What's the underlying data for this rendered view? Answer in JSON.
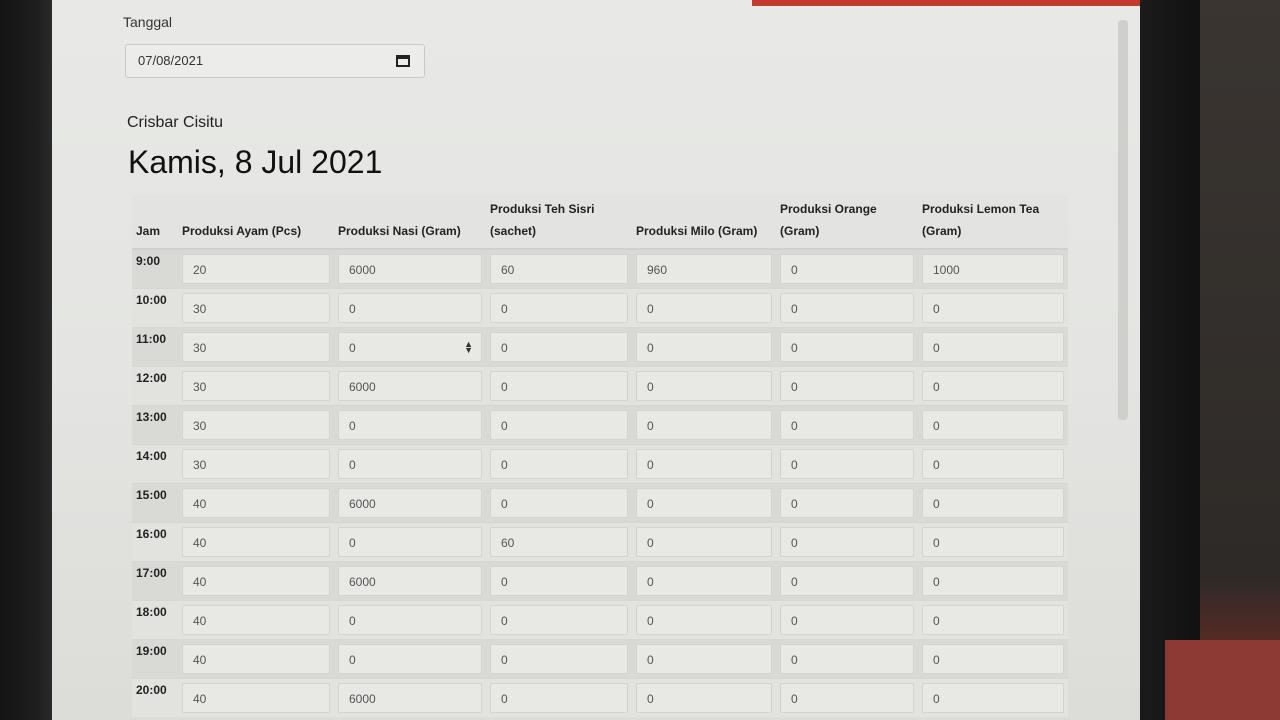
{
  "form": {
    "date_label": "Tanggal",
    "date_value": "07/08/2021",
    "store_name": "Crisbar Cisitu",
    "day_title": "Kamis, 8 Jul 2021"
  },
  "table": {
    "headers": [
      "Jam",
      "Produksi Ayam (Pcs)",
      "Produksi Nasi (Gram)",
      "Produksi Teh Sisri (sachet)",
      "Produksi Milo (Gram)",
      "Produksi Orange (Gram)",
      "Produksi Lemon Tea (Gram)"
    ],
    "rows": [
      {
        "jam": "9:00",
        "values": [
          "20",
          "6000",
          "60",
          "960",
          "0",
          "1000"
        ]
      },
      {
        "jam": "10:00",
        "values": [
          "30",
          "0",
          "0",
          "0",
          "0",
          "0"
        ]
      },
      {
        "jam": "11:00",
        "values": [
          "30",
          "0",
          "0",
          "0",
          "0",
          "0"
        ]
      },
      {
        "jam": "12:00",
        "values": [
          "30",
          "6000",
          "0",
          "0",
          "0",
          "0"
        ]
      },
      {
        "jam": "13:00",
        "values": [
          "30",
          "0",
          "0",
          "0",
          "0",
          "0"
        ]
      },
      {
        "jam": "14:00",
        "values": [
          "30",
          "0",
          "0",
          "0",
          "0",
          "0"
        ]
      },
      {
        "jam": "15:00",
        "values": [
          "40",
          "6000",
          "0",
          "0",
          "0",
          "0"
        ]
      },
      {
        "jam": "16:00",
        "values": [
          "40",
          "0",
          "60",
          "0",
          "0",
          "0"
        ]
      },
      {
        "jam": "17:00",
        "values": [
          "40",
          "6000",
          "0",
          "0",
          "0",
          "0"
        ]
      },
      {
        "jam": "18:00",
        "values": [
          "40",
          "0",
          "0",
          "0",
          "0",
          "0"
        ]
      },
      {
        "jam": "19:00",
        "values": [
          "40",
          "0",
          "0",
          "0",
          "0",
          "0"
        ]
      },
      {
        "jam": "20:00",
        "values": [
          "40",
          "6000",
          "0",
          "0",
          "0",
          "0"
        ]
      }
    ]
  },
  "icons": {
    "calendar": "calendar-icon",
    "spinner": "number-spinner-icon"
  },
  "colors": {
    "accent_bar": "#c23a2e"
  }
}
